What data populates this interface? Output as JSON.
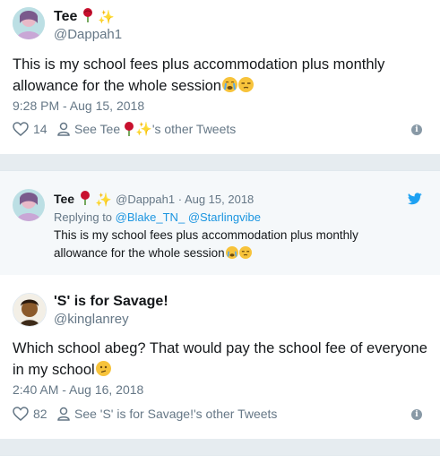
{
  "tweet1": {
    "display_name": "Tee",
    "handle": "@Dappah1",
    "text": "This is my school fees plus accommodation plus monthly allowance for the whole session",
    "timestamp": "9:28 PM - Aug 15, 2018",
    "likes": "14",
    "see_other_prefix": "See Tee",
    "see_other_suffix": "'s other Tweets",
    "icons": [
      "heart-icon",
      "person-icon",
      "info-icon",
      "rose-emoji",
      "sparkles-emoji",
      "crying-face-emoji",
      "unamused-face-emoji"
    ]
  },
  "quoted": {
    "display_name": "Tee",
    "handle_date": "@Dappah1 · Aug 15, 2018",
    "replying_prefix": "Replying to",
    "reply_to_1": "@Blake_TN_",
    "reply_to_2": "@Starlingvibe",
    "text": "This is my school fees plus accommodation plus monthly allowance for the whole session",
    "icons": [
      "twitter-bird-icon"
    ]
  },
  "tweet2": {
    "display_name": "'S' is for Savage!",
    "handle": "@kinglanrey",
    "text": "Which school abeg? That would pay the school fee of everyone in my school",
    "timestamp": "2:40 AM - Aug 16, 2018",
    "likes": "82",
    "see_other": "See 'S' is for Savage!'s other Tweets",
    "icons": [
      "heart-icon",
      "person-icon",
      "info-icon",
      "confused-face-emoji"
    ]
  },
  "colors": {
    "accent": "#1b95e0",
    "muted": "#657786",
    "separator": "#e6ecf0",
    "quote_bg": "#f5f8fa"
  }
}
